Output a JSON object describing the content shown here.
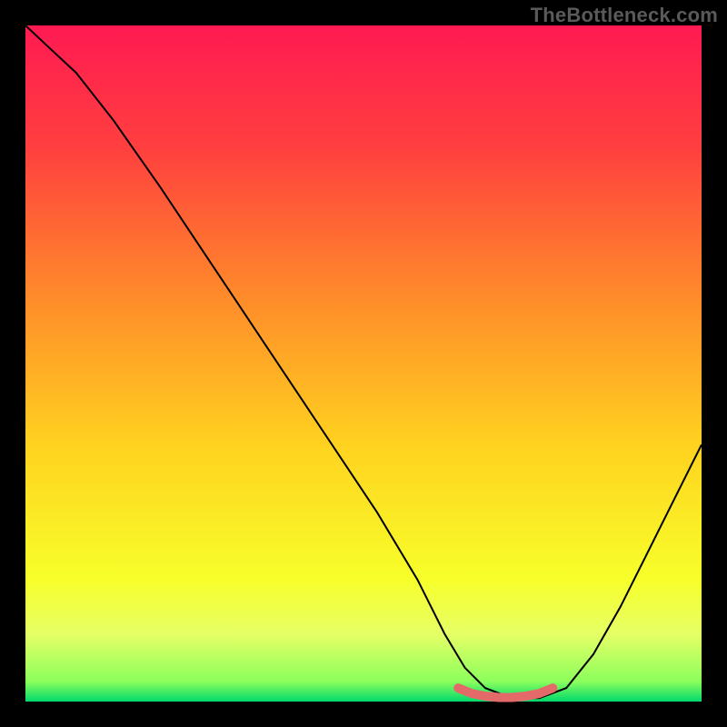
{
  "watermark": "TheBottleneck.com",
  "chart_data": {
    "type": "line",
    "title": "",
    "xlabel": "",
    "ylabel": "",
    "xlim": [
      0,
      100
    ],
    "ylim": [
      0,
      100
    ],
    "background_gradient": {
      "stops": [
        {
          "offset": 0.0,
          "color": "#ff1a52"
        },
        {
          "offset": 0.18,
          "color": "#ff3f3f"
        },
        {
          "offset": 0.4,
          "color": "#ff8a2a"
        },
        {
          "offset": 0.62,
          "color": "#ffd21f"
        },
        {
          "offset": 0.82,
          "color": "#f7ff2a"
        },
        {
          "offset": 0.9,
          "color": "#e6ff66"
        },
        {
          "offset": 0.97,
          "color": "#8cff5c"
        },
        {
          "offset": 1.0,
          "color": "#00d96b"
        }
      ]
    },
    "series": [
      {
        "name": "bottleneck-curve",
        "color": "#000000",
        "width": 2,
        "x": [
          0.0,
          3.2,
          7.5,
          13.0,
          20.0,
          28.0,
          36.0,
          44.0,
          52.0,
          58.0,
          62.0,
          65.0,
          68.0,
          72.0,
          76.0,
          80.0,
          84.0,
          88.0,
          92.0,
          96.0,
          100.0
        ],
        "y": [
          100.0,
          97.0,
          93.0,
          86.0,
          76.0,
          64.0,
          52.0,
          40.0,
          28.0,
          18.0,
          10.0,
          5.0,
          2.0,
          0.5,
          0.5,
          2.0,
          7.0,
          14.0,
          22.0,
          30.0,
          38.0
        ]
      },
      {
        "name": "highlight-segment",
        "color": "#e46a6a",
        "width": 10,
        "linecap": "round",
        "x": [
          64.0,
          66.0,
          68.0,
          70.0,
          72.0,
          74.0,
          76.0,
          78.0
        ],
        "y": [
          2.0,
          1.2,
          0.8,
          0.6,
          0.6,
          0.8,
          1.2,
          2.0
        ]
      }
    ]
  }
}
